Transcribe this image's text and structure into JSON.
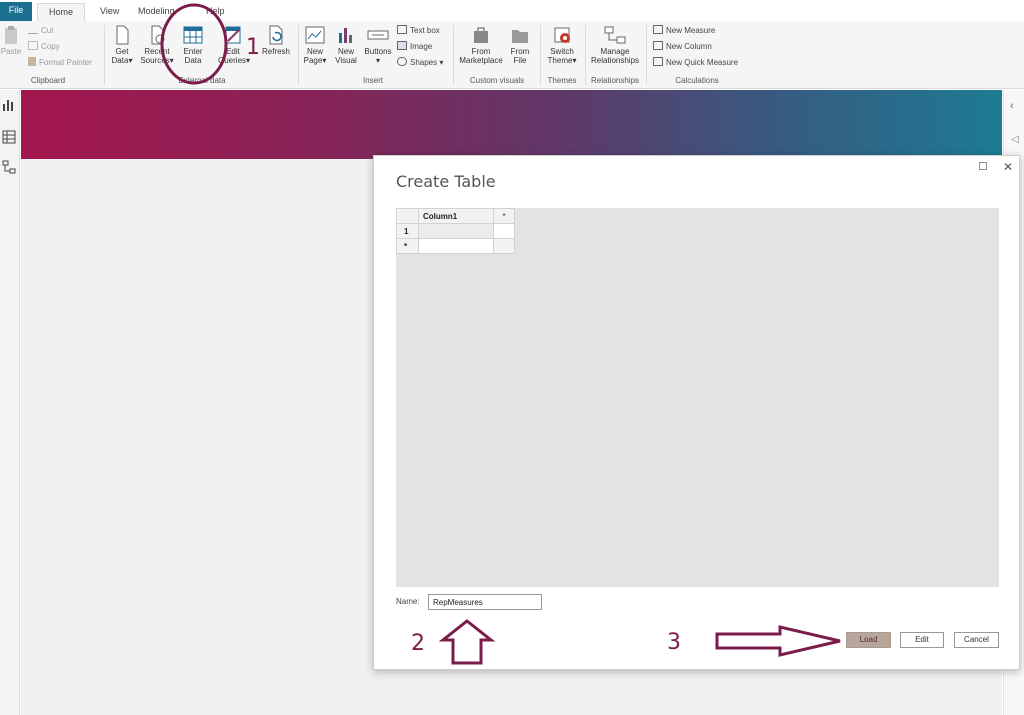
{
  "tabs": {
    "file": "File",
    "home": "Home",
    "view": "View",
    "modeling": "Modeling",
    "help": "Help"
  },
  "ribbon": {
    "clipboard": {
      "paste": "Paste",
      "cut": "Cut",
      "copy": "Copy",
      "format_painter": "Format Painter",
      "label": "Clipboard"
    },
    "external_data": {
      "get_data": [
        "Get",
        "Data"
      ],
      "recent_sources": [
        "Recent",
        "Sources"
      ],
      "enter_data": [
        "Enter",
        "Data"
      ],
      "edit_queries": [
        "Edit",
        "Queries"
      ],
      "refresh": "Refresh",
      "label": "External data"
    },
    "insert": {
      "new_page": [
        "New",
        "Page"
      ],
      "new_visual": [
        "New",
        "Visual"
      ],
      "buttons": "Buttons",
      "text_box": "Text box",
      "image": "Image",
      "shapes": "Shapes",
      "label": "Insert"
    },
    "custom_visuals": {
      "from_marketplace": [
        "From",
        "Marketplace"
      ],
      "from_file": [
        "From",
        "File"
      ],
      "label": "Custom visuals"
    },
    "themes": {
      "switch_theme": [
        "Switch",
        "Theme"
      ],
      "label": "Themes"
    },
    "relationships": {
      "manage": [
        "Manage",
        "Relationships"
      ],
      "label": "Relationships"
    },
    "calculations": {
      "new_measure": "New Measure",
      "new_column": "New Column",
      "new_quick_measure": "New Quick Measure",
      "label": "Calculations"
    }
  },
  "dialog": {
    "title": "Create Table",
    "maximize": "☐",
    "close": "✕",
    "table": {
      "headers": [
        "Column1",
        "*"
      ],
      "rows": [
        "1",
        "*"
      ]
    },
    "name_label": "Name:",
    "name_value": "RepMeasures",
    "buttons": {
      "load": "Load",
      "edit": "Edit",
      "cancel": "Cancel"
    }
  },
  "annotations": {
    "one": "1",
    "two": "2",
    "three": "3"
  },
  "colors": {
    "accent": "#7b1c4a",
    "file_tab": "#1b6f8f"
  }
}
